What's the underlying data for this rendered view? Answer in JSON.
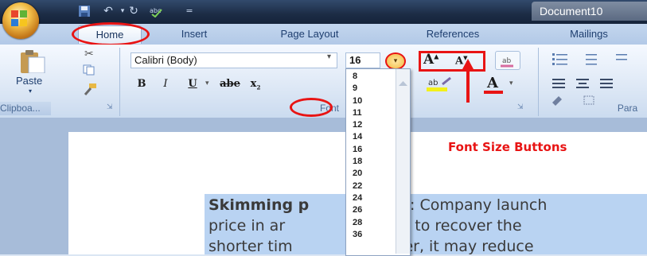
{
  "window": {
    "document_title": "Document10"
  },
  "tabs": [
    {
      "label": "Home",
      "active": true
    },
    {
      "label": "Insert"
    },
    {
      "label": "Page Layout"
    },
    {
      "label": "References"
    },
    {
      "label": "Mailings"
    }
  ],
  "clipboard": {
    "paste_label": "Paste",
    "group_label": "Clipboa...",
    "cut_icon": "scissors-icon",
    "copy_icon": "copy-icon",
    "format_painter_icon": "brush-icon"
  },
  "font": {
    "font_name": "Calibri (Body)",
    "font_size": "16",
    "group_label": "Font",
    "bold": "B",
    "italic": "I",
    "underline": "U",
    "strikethrough": "abe",
    "subscript": "x",
    "grow_font": "A",
    "shrink_font": "A",
    "font_color": "A",
    "highlight_label": "ab"
  },
  "paragraph": {
    "group_label": "Para"
  },
  "font_size_list": [
    "8",
    "9",
    "10",
    "11",
    "12",
    "14",
    "16",
    "18",
    "20",
    "22",
    "24",
    "26",
    "28",
    "36"
  ],
  "annotation": {
    "text": "Font Size Buttons",
    "color": "#e81414"
  },
  "document": {
    "lines": [
      {
        "bold": "Skimming p",
        "rest": "g:  Company launch",
        "hidden_gap": true
      },
      {
        "text": "price in ar",
        "rest": "rt to recover the"
      },
      {
        "text": "shorter tim",
        "rest": "ter, it may reduce"
      }
    ]
  },
  "colors": {
    "accent_red": "#e81414",
    "ribbon_blue": "#dbe6f4",
    "highlight": "#b9d3f2"
  }
}
